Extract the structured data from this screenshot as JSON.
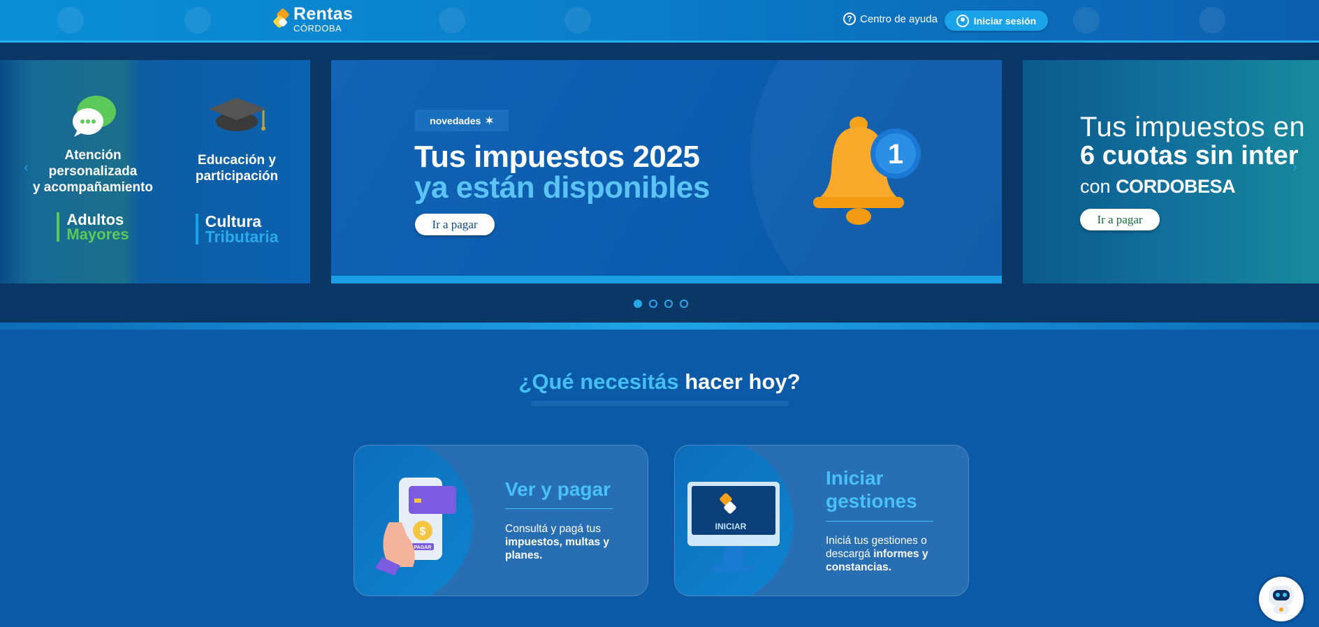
{
  "header": {
    "logo_main": "Rentas",
    "logo_sub": "CÓRDOBA",
    "help_label": "Centro de ayuda",
    "login_label": "Iniciar sesión"
  },
  "carousel": {
    "left_panel": {
      "col1_title_lines": [
        "Atención",
        "personalizada",
        "y acompañamiento"
      ],
      "col1_logo_top": "Adultos",
      "col1_logo_bottom": "Mayores",
      "col2_title_lines": [
        "Educación y",
        "participación"
      ],
      "col2_logo_top": "Cultura",
      "col2_logo_bottom": "Tributaria"
    },
    "main_slide": {
      "badge": "novedades",
      "title_line1": "Tus impuestos 2025",
      "title_line2": "ya están disponibles",
      "button": "Ir a pagar",
      "bell_number": "1"
    },
    "right_panel": {
      "line1": "Tus impuestos en",
      "line2": "6 cuotas sin inter",
      "line3_prefix": "con",
      "line3_brand": "CORDOBESA",
      "button": "Ir a pagar"
    },
    "dots": [
      true,
      false,
      false,
      false
    ]
  },
  "section": {
    "question_accent": "¿Qué necesitás",
    "question_rest": "hacer hoy?"
  },
  "cards": [
    {
      "title": "Ver y pagar",
      "desc_plain": "Consultá y pagá tus",
      "desc_bold": "impuestos, multas y planes.",
      "image_label": "PAGAR"
    },
    {
      "title_line1": "Iniciar",
      "title_line2": "gestiones",
      "desc_plain": "Iniciá tus gestiones o descargá",
      "desc_bold": "informes y constancias.",
      "image_label": "INICIAR"
    }
  ],
  "colors": {
    "accent_light": "#44c0f5",
    "header_blue": "#0b7cc8",
    "band_dark": "#0b3766",
    "green": "#5cc95a",
    "orange": "#f7a31a"
  }
}
